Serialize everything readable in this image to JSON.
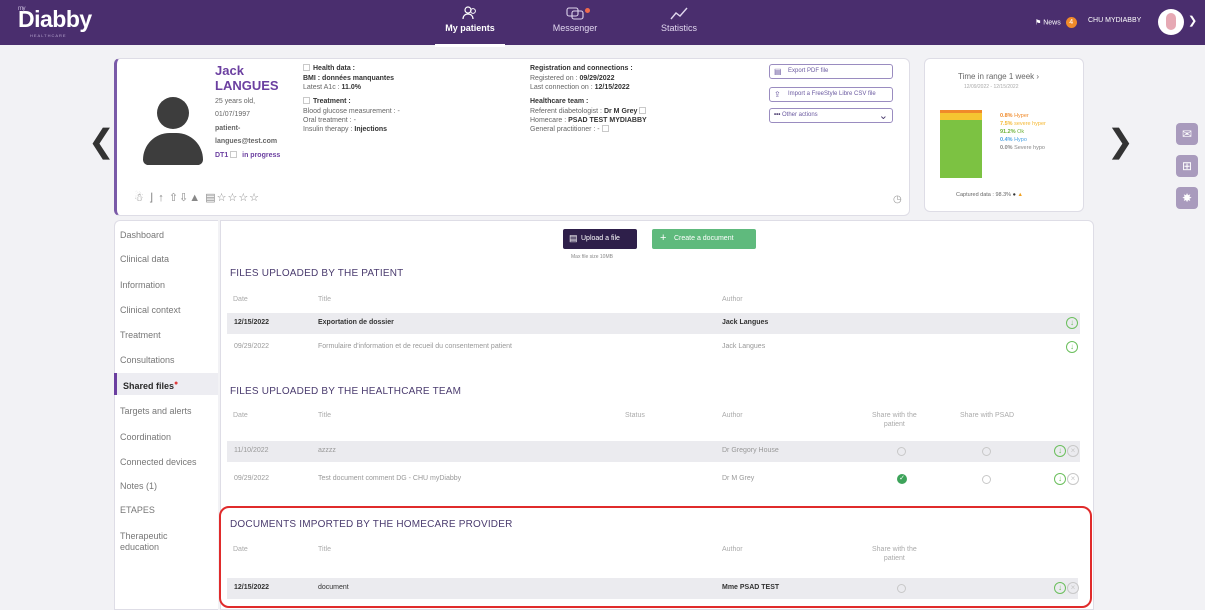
{
  "app": {
    "logo_prefix": "my",
    "logo": "Diabby",
    "logo_sub": "HEALTHCARE"
  },
  "nav": [
    {
      "label": "My patients",
      "icon": "patients-icon",
      "active": true
    },
    {
      "label": "Messenger",
      "icon": "messenger-icon",
      "active": false
    },
    {
      "label": "Statistics",
      "icon": "statistics-icon",
      "active": false
    }
  ],
  "topright": {
    "news_label": "News",
    "news_count": "4",
    "org": "CHU MYDIABBY"
  },
  "patient": {
    "first_name": "Jack",
    "last_name": "LANGUES",
    "age": "25 years old,",
    "dob": "01/07/1997",
    "email_1": "patient-",
    "email_2": "langues@test.com",
    "diabetes_type": "DT1",
    "status": "in progress"
  },
  "health": {
    "title": "Health data :",
    "bmi": "BMI : données manquantes",
    "hba1c_label": "Latest A1c :",
    "hba1c_value": "11.0%",
    "treatment_title": "Treatment :",
    "glucose": "Blood glucose measurement : -",
    "oral": "Oral treatment : -",
    "insulin_label": "Insulin therapy :",
    "insulin_value": "Injections"
  },
  "registration": {
    "title": "Registration and connections :",
    "registered_label": "Registered on :",
    "registered_value": "09/29/2022",
    "last_conn_label": "Last connection on :",
    "last_conn_value": "12/15/2022",
    "team_title": "Healthcare team :",
    "referent_label": "Referent diabetologist :",
    "referent_value": "Dr M Grey",
    "homecare_label": "Homecare :",
    "homecare_value": "PSAD TEST MYDIABBY",
    "gp": "General practitioner : -"
  },
  "actions": {
    "export_pdf": "Export PDF file",
    "import_csv": "Import a FreeStyle Libre CSV file",
    "other": "Other actions"
  },
  "tir": {
    "title": "Time in range 1 week",
    "dates": "12/09/2022 - 12/15/2022",
    "hyper_pct": "0.8%",
    "hyper_label": "Hyper",
    "severe_hyper_pct": "7.5%",
    "severe_hyper_label": "severe hyper",
    "ok_pct": "91.2%",
    "ok_label": "Ok",
    "hypo_pct": "0.4%",
    "hypo_label": "Hypo",
    "severe_hypo_pct": "0.0%",
    "severe_hypo_label": "Severe hypo",
    "captured": "Captured data : 98.3%",
    "colors": {
      "hyper": "#f08a2a",
      "severe_hyper": "#f5c531",
      "ok": "#7cc242",
      "hypo": "#64b5f6"
    }
  },
  "menu": [
    {
      "label": "Dashboard"
    },
    {
      "label": "Clinical data"
    },
    {
      "label": "Information"
    },
    {
      "label": "Clinical context"
    },
    {
      "label": "Treatment"
    },
    {
      "label": "Consultations"
    },
    {
      "label": "Shared files",
      "active": true
    },
    {
      "label": "Targets and alerts"
    },
    {
      "label": "Coordination"
    },
    {
      "label": "Connected devices"
    },
    {
      "label": "Notes (1)"
    },
    {
      "label": "ETAPES"
    },
    {
      "label": "Therapeutic education"
    }
  ],
  "toolbar": {
    "upload": "Upload a file",
    "create": "Create a document",
    "max_size": "Max file size 10MB"
  },
  "patient_files": {
    "title": "FILES UPLOADED BY THE PATIENT",
    "headers": {
      "date": "Date",
      "title": "Title",
      "author": "Author"
    },
    "rows": [
      {
        "date": "12/15/2022",
        "title": "Exportation de dossier",
        "author": "Jack Langues"
      },
      {
        "date": "09/29/2022",
        "title": "Formulaire d'information et de recueil du consentement patient",
        "author": "Jack Langues"
      }
    ]
  },
  "team_files": {
    "title": "FILES UPLOADED BY THE HEALTHCARE TEAM",
    "headers": {
      "date": "Date",
      "title": "Title",
      "status": "Status",
      "author": "Author",
      "share_patient_1": "Share with the",
      "share_patient_2": "patient",
      "share_psad": "Share with PSAD"
    },
    "rows": [
      {
        "date": "11/10/2022",
        "title": "azzzz",
        "author": "Dr Gregory House",
        "shared_patient": false
      },
      {
        "date": "09/29/2022",
        "title": "Test document comment DG - CHU myDiabby",
        "author": "Dr M Grey",
        "shared_patient": true
      }
    ]
  },
  "homecare_docs": {
    "title": "DOCUMENTS IMPORTED BY THE HOMECARE PROVIDER",
    "headers": {
      "date": "Date",
      "title": "Title",
      "author": "Author",
      "share_patient_1": "Share with the",
      "share_patient_2": "patient"
    },
    "rows": [
      {
        "date": "12/15/2022",
        "title": "document",
        "author": "Mme PSAD TEST"
      }
    ]
  }
}
